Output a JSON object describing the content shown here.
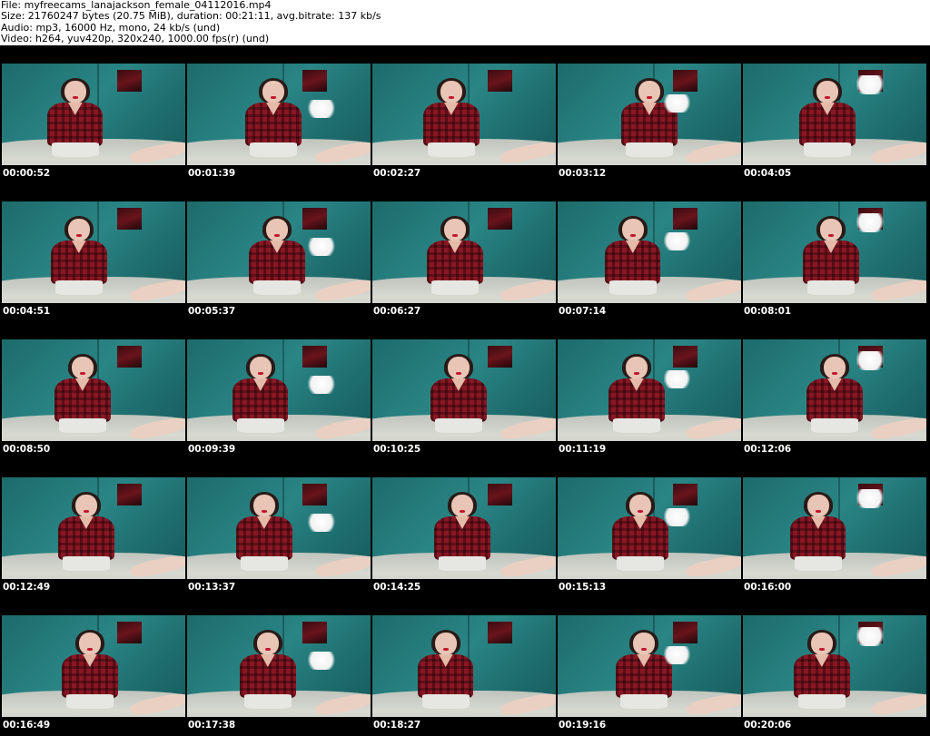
{
  "header": {
    "file": "File: myfreecams_lanajackson_female_04112016.mp4",
    "size": "Size: 21760247 bytes (20.75 MiB), duration: 00:21:11, avg.bitrate: 137 kb/s",
    "audio": "Audio: mp3, 16000 Hz, mono, 24 kb/s (und)",
    "video": "Video: h264, yuv420p, 320x240, 1000.00 fps(r) (und)"
  },
  "thumbnails": [
    {
      "time": "00:00:52"
    },
    {
      "time": "00:01:39"
    },
    {
      "time": "00:02:27"
    },
    {
      "time": "00:03:12"
    },
    {
      "time": "00:04:05"
    },
    {
      "time": "00:04:51"
    },
    {
      "time": "00:05:37"
    },
    {
      "time": "00:06:27"
    },
    {
      "time": "00:07:14"
    },
    {
      "time": "00:08:01"
    },
    {
      "time": "00:08:50"
    },
    {
      "time": "00:09:39"
    },
    {
      "time": "00:10:25"
    },
    {
      "time": "00:11:19"
    },
    {
      "time": "00:12:06"
    },
    {
      "time": "00:12:49"
    },
    {
      "time": "00:13:37"
    },
    {
      "time": "00:14:25"
    },
    {
      "time": "00:15:13"
    },
    {
      "time": "00:16:00"
    },
    {
      "time": "00:16:49"
    },
    {
      "time": "00:17:38"
    },
    {
      "time": "00:18:27"
    },
    {
      "time": "00:19:16"
    },
    {
      "time": "00:20:06"
    }
  ]
}
